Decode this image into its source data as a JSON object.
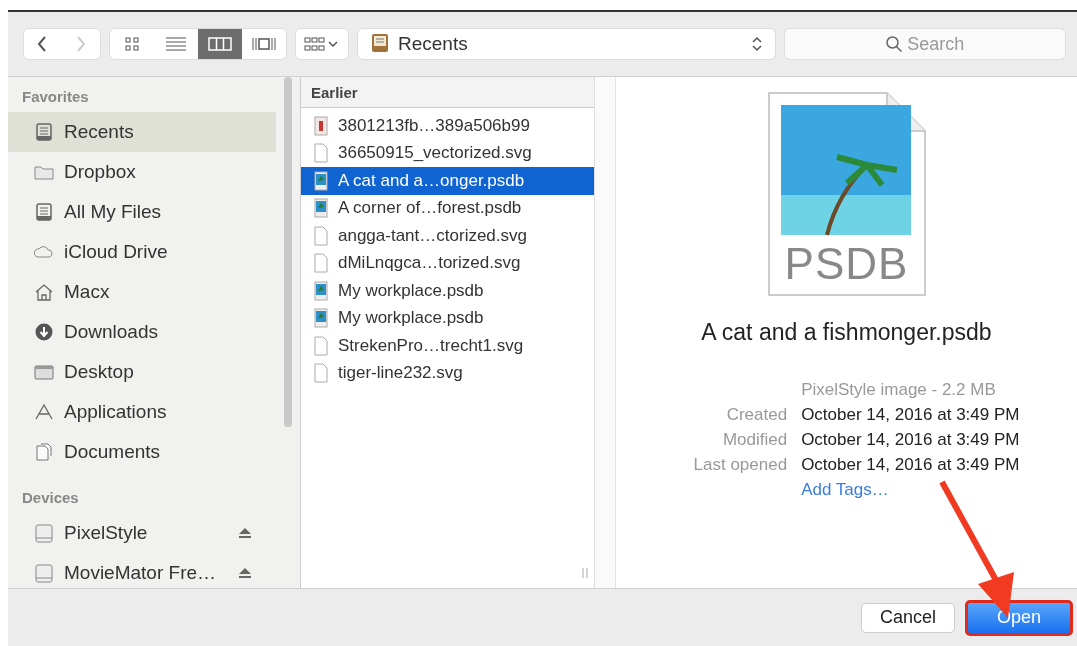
{
  "toolbar": {
    "nav": [
      {
        "kind": "back",
        "disabled": false
      },
      {
        "kind": "forward",
        "disabled": true
      }
    ],
    "views": [
      {
        "kind": "icons",
        "selected": false
      },
      {
        "kind": "list",
        "selected": false
      },
      {
        "kind": "columns",
        "selected": true
      },
      {
        "kind": "coverflow",
        "selected": false
      }
    ],
    "location": "Recents",
    "search": {
      "placeholder": "Search"
    }
  },
  "sidebar": {
    "sections": [
      {
        "title": "Favorites",
        "items": [
          {
            "label": "Recents",
            "kind": "tray",
            "selected": true,
            "ejectable": false
          },
          {
            "label": "Dropbox",
            "kind": "folder",
            "selected": false,
            "ejectable": false
          },
          {
            "label": "All My Files",
            "kind": "tray",
            "selected": false,
            "ejectable": false
          },
          {
            "label": "iCloud Drive",
            "kind": "cloud",
            "selected": false,
            "ejectable": false
          },
          {
            "label": "Macx",
            "kind": "home",
            "selected": false,
            "ejectable": false
          },
          {
            "label": "Downloads",
            "kind": "download",
            "selected": false,
            "ejectable": false
          },
          {
            "label": "Desktop",
            "kind": "desktop",
            "selected": false,
            "ejectable": false
          },
          {
            "label": "Applications",
            "kind": "apps",
            "selected": false,
            "ejectable": false
          },
          {
            "label": "Documents",
            "kind": "docs",
            "selected": false,
            "ejectable": false
          }
        ]
      },
      {
        "title": "Devices",
        "items": [
          {
            "label": "PixelStyle",
            "kind": "drive",
            "selected": false,
            "ejectable": true
          },
          {
            "label": "MovieMator Fre…",
            "kind": "drive",
            "selected": false,
            "ejectable": true
          }
        ]
      }
    ]
  },
  "file_list": {
    "header": "Earlier",
    "files": [
      {
        "name": "3801213fb…389a506b99",
        "kind": "picture",
        "selected": false
      },
      {
        "name": "36650915_vectorized.svg",
        "kind": "blank",
        "selected": false
      },
      {
        "name": "A cat and a…onger.psdb",
        "kind": "psdb",
        "selected": true
      },
      {
        "name": "A corner of…forest.psdb",
        "kind": "psdb",
        "selected": false
      },
      {
        "name": "angga-tant…ctorized.svg",
        "kind": "blank",
        "selected": false
      },
      {
        "name": "dMiLnqgca…torized.svg",
        "kind": "blank",
        "selected": false
      },
      {
        "name": "My workplace.psdb",
        "kind": "psdb",
        "selected": false
      },
      {
        "name": "My workplace.psdb",
        "kind": "psdb",
        "selected": false
      },
      {
        "name": "StrekenPro…trecht1.svg",
        "kind": "blank",
        "selected": false
      },
      {
        "name": "tiger-line232.svg",
        "kind": "blank",
        "selected": false
      }
    ]
  },
  "preview": {
    "icon_label": "PSDB",
    "name": "A cat and a fishmonger.psdb",
    "kind_size": "PixelStyle image - 2.2 MB",
    "details": [
      {
        "label": "Created",
        "value": "October 14, 2016 at 3:49 PM"
      },
      {
        "label": "Modified",
        "value": "October 14, 2016 at 3:49 PM"
      },
      {
        "label": "Last opened",
        "value": "October 14, 2016 at 3:49 PM"
      }
    ],
    "add_tags": "Add Tags…"
  },
  "buttons": [
    {
      "label": "Cancel",
      "kind": "cancel",
      "highlighted": false
    },
    {
      "label": "Open",
      "kind": "default",
      "highlighted": true
    }
  ]
}
